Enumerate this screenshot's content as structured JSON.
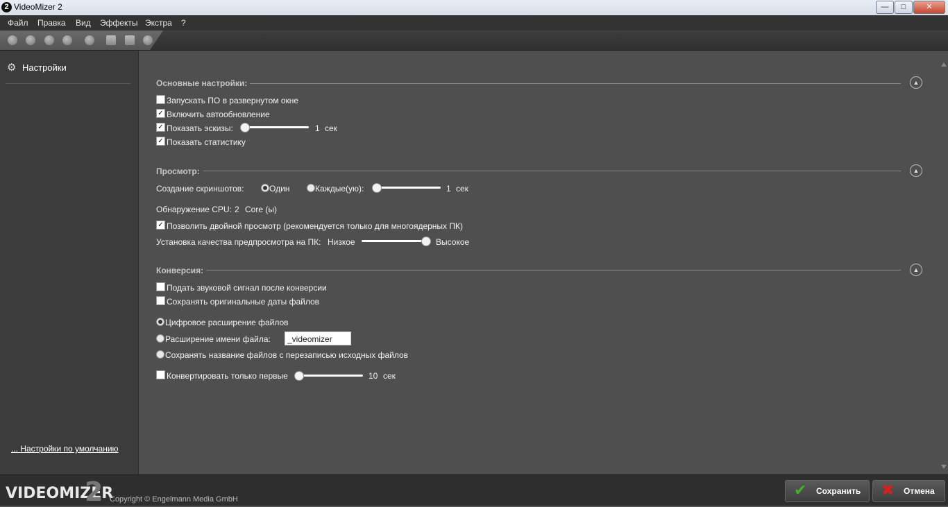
{
  "window": {
    "title": "VideoMizer 2",
    "app_icon": "2"
  },
  "menu": [
    "Файл",
    "Правка",
    "Вид",
    "Эффекты",
    "Экстра",
    "?"
  ],
  "sidebar": {
    "items": [
      {
        "label": "Настройки",
        "icon": "gear-icon"
      }
    ],
    "defaults_link": "... Настройки по умолчанию"
  },
  "sections": {
    "basic": {
      "title": "Основные настройки:",
      "start_maximized": {
        "label": "Запускать ПО в развернутом окне",
        "checked": false
      },
      "auto_update": {
        "label": "Включить автообновление",
        "checked": true
      },
      "show_thumbs": {
        "label": "Показать эскизы:",
        "checked": true,
        "value": "1",
        "unit": "сек"
      },
      "show_stats": {
        "label": "Показать статистику",
        "checked": true
      }
    },
    "preview": {
      "title": "Просмотр:",
      "screens_label": "Создание скриншотов:",
      "opt_once": "Один",
      "opt_every": "Каждые(ую):",
      "screens_value": "1",
      "screens_unit": "сек",
      "cpu_label": "Обнаружение CPU:",
      "cpu_value": "2",
      "cpu_unit": "Core (ы)",
      "dual_preview": {
        "label": "Позволить двойной просмотр (рекомендуется только для многоядерных ПК)",
        "checked": true
      },
      "quality_label": "Установка качества предпросмотра на ПК:",
      "quality_low": "Низкое",
      "quality_high": "Высокое",
      "quality_level": 1.0
    },
    "conversion": {
      "title": "Конверсия:",
      "beep": {
        "label": "Подать звуковой сигнал после конверсии",
        "checked": false
      },
      "keep_dates": {
        "label": "Сохранять оригинальные даты файлов",
        "checked": false
      },
      "opt_digital": "Цифровое расширение файлов",
      "opt_suffix": "Расширение имени файла:",
      "suffix_value": "_videomizer",
      "opt_overwrite": "Сохранять название файлов с перезаписью исходных файлов",
      "first_only": {
        "label": "Конвертировать только первые",
        "checked": false,
        "value": "10",
        "unit": "сек"
      }
    }
  },
  "footer": {
    "logo_text": "VIDEOMIZER",
    "logo_number": "2",
    "copyright": "Copyright © Engelmann Media GmbH",
    "save_label": "Сохранить",
    "cancel_label": "Отмена"
  },
  "colors": {
    "save_check": "#43b02a",
    "cancel_x": "#d62020"
  }
}
